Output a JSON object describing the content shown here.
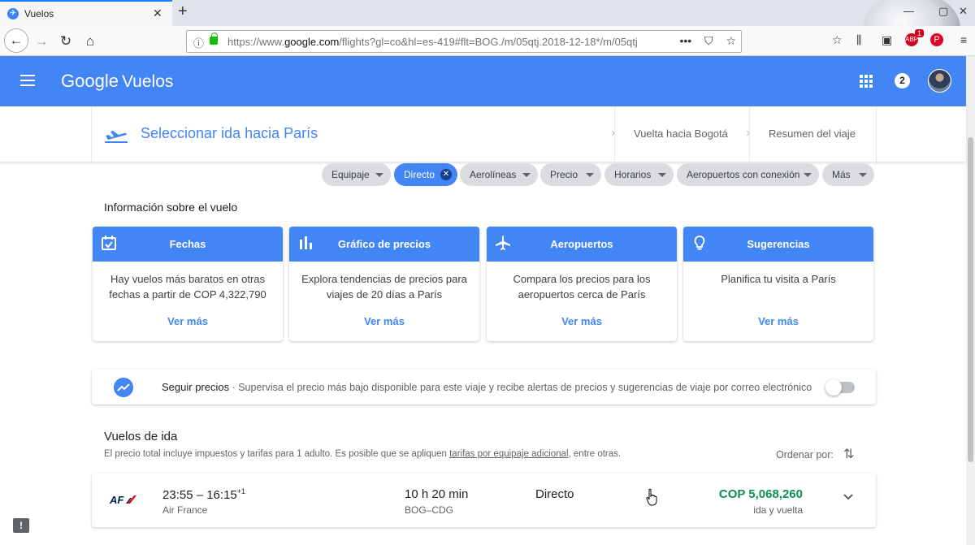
{
  "browser": {
    "tab_title": "Vuelos",
    "tab_close": "✕",
    "new_tab": "+",
    "url_prefix": "https://www.",
    "url_domain": "google.com",
    "url_rest": "/flights?gl=co&hl=es-419#flt=BOG./m/05qtj.2018-12-18*/m/05qtj",
    "url_more": "•••",
    "addon_badge": "1"
  },
  "header": {
    "brand_google": "Google",
    "brand_product": "Vuelos",
    "notifications": "2"
  },
  "steps": {
    "current": "Seleccionar ida hacia París",
    "return": "Vuelta hacia Bogotá",
    "summary": "Resumen del viaje"
  },
  "filters": [
    {
      "label": "Equipaje",
      "active": false
    },
    {
      "label": "Directo",
      "active": true
    },
    {
      "label": "Aerolíneas",
      "active": false
    },
    {
      "label": "Precio",
      "active": false
    },
    {
      "label": "Horarios",
      "active": false
    },
    {
      "label": "Aeropuertos con conexión",
      "active": false
    },
    {
      "label": "Más",
      "active": false
    }
  ],
  "info": {
    "title": "Información sobre el vuelo",
    "cards": [
      {
        "icon": "calendar-icon",
        "title": "Fechas",
        "body": "Hay vuelos más baratos en otras fechas a partir de COP 4,322,790",
        "link": "Ver más"
      },
      {
        "icon": "bar-chart-icon",
        "title": "Gráfico de precios",
        "body": "Explora tendencias de precios para viajes de 20 días a París",
        "link": "Ver más"
      },
      {
        "icon": "airplane-icon",
        "title": "Aeropuertos",
        "body": "Compara los precios para los aeropuertos cerca de París",
        "link": "Ver más"
      },
      {
        "icon": "lightbulb-icon",
        "title": "Sugerencias",
        "body": "Planifica tu visita a París",
        "link": "Ver más"
      }
    ]
  },
  "track": {
    "label": "Seguir precios",
    "description": " · Supervisa el precio más bajo disponible para este viaje y recibe alertas de precios y sugerencias de viaje por correo electrónico",
    "enabled": false
  },
  "results": {
    "title": "Vuelos de ida",
    "note_before": "El precio total incluye impuestos y tarifas para 1 adulto. Es posible que se apliquen ",
    "note_link": "tarifas por equipaje adicional",
    "note_after": ", entre otras.",
    "sort_label": "Ordenar por:",
    "flights": [
      {
        "times": "23:55 – 16:15",
        "day_offset": "+1",
        "airline": "Air France",
        "duration": "10 h 20 min",
        "route": "BOG–CDG",
        "stops": "Directo",
        "price": "COP 5,068,260",
        "price_type": "ida y vuelta"
      }
    ]
  },
  "feedback": "!",
  "colors": {
    "brand_blue": "#4285f4",
    "price_green": "#0d904f",
    "chip_gray": "#dadce0"
  }
}
